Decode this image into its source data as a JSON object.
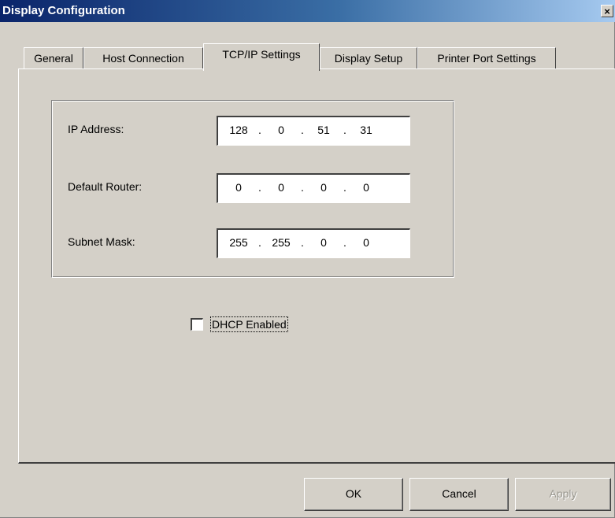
{
  "window": {
    "title": "Display Configuration",
    "close_glyph": "×"
  },
  "tabs": [
    {
      "label": "General",
      "active": false
    },
    {
      "label": "Host Connection",
      "active": false
    },
    {
      "label": "TCP/IP Settings",
      "active": true
    },
    {
      "label": "Display Setup",
      "active": false
    },
    {
      "label": "Printer Port Settings",
      "active": false
    }
  ],
  "tcpip": {
    "ip_address": {
      "label": "IP Address:",
      "octets": [
        "128",
        "0",
        "51",
        "31"
      ]
    },
    "default_router": {
      "label": "Default Router:",
      "octets": [
        "0",
        "0",
        "0",
        "0"
      ]
    },
    "subnet_mask": {
      "label": "Subnet Mask:",
      "octets": [
        "255",
        "255",
        "0",
        "0"
      ]
    },
    "separator": ".",
    "dhcp": {
      "label": "DHCP Enabled",
      "checked": false
    }
  },
  "buttons": {
    "ok": "OK",
    "cancel": "Cancel",
    "apply": "Apply",
    "apply_enabled": false
  },
  "colors": {
    "titlebar_start": "#0a246a",
    "titlebar_end": "#a6caf0",
    "face": "#d4d0c8"
  }
}
